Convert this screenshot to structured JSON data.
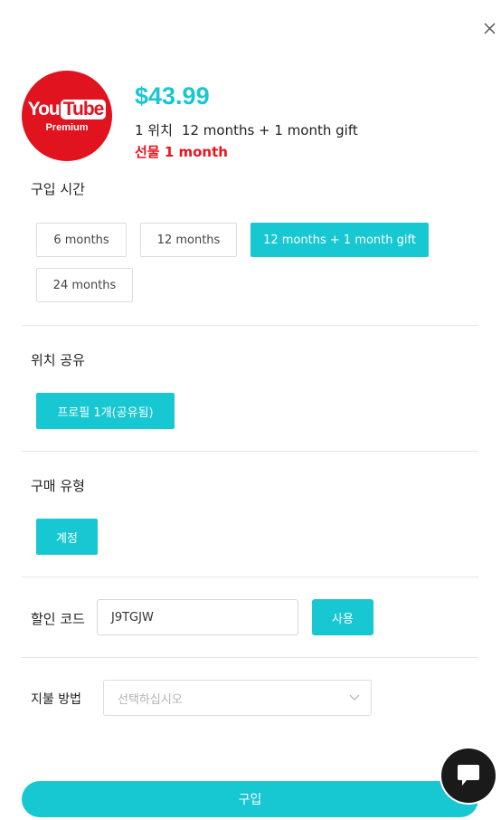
{
  "product": {
    "logo_word_you": "You",
    "logo_word_tube": "Tube",
    "logo_sub": "Premium",
    "price": "$43.99",
    "seats": "1 위치",
    "period": "12 months + 1 month gift",
    "gift": "선물 1 month"
  },
  "purchase_time": {
    "label": "구입 시간",
    "options": [
      "6 months",
      "12 months",
      "12 months + 1 month gift",
      "24 months"
    ],
    "selected": "12 months + 1 month gift"
  },
  "location_share": {
    "label": "위치 공유",
    "option": "프로필 1개(공유됨)"
  },
  "purchase_type": {
    "label": "구매 유형",
    "option": "계정"
  },
  "discount": {
    "label": "할인 코드",
    "value": "J9TGJW",
    "apply_label": "사용"
  },
  "payment": {
    "label": "지불 방법",
    "placeholder": "선택하십시오"
  },
  "buy_label": "구입",
  "colors": {
    "accent": "#17c7d2",
    "gift_red": "#e8141e",
    "logo_red": "#e0131e"
  },
  "icons": {
    "close": "close-icon",
    "chevron": "chevron-down-icon",
    "chat": "chat-bubble-icon"
  }
}
